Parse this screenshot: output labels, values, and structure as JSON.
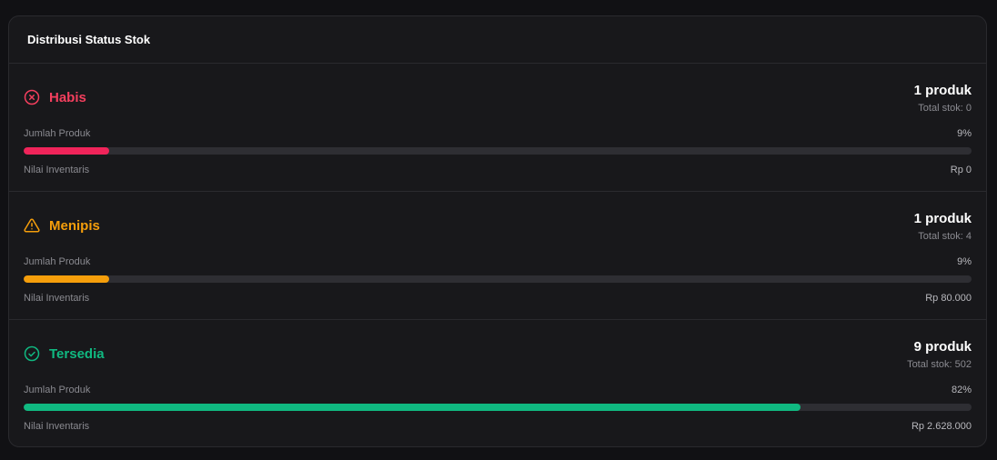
{
  "card": {
    "title": "Distribusi Status Stok"
  },
  "rows": [
    {
      "status": "Habis",
      "icon": "x-circle-icon",
      "color": "#f43f5e",
      "bar_color": "#f0245a",
      "count": "1 produk",
      "total": "Total stok: 0",
      "metric_label": "Jumlah Produk",
      "percent": "9%",
      "fill_percent": 9,
      "value_label": "Nilai Inventaris",
      "value": "Rp 0"
    },
    {
      "status": "Menipis",
      "icon": "warning-triangle-icon",
      "color": "#f59e0b",
      "bar_color": "#f59e0b",
      "count": "1 produk",
      "total": "Total stok: 4",
      "metric_label": "Jumlah Produk",
      "percent": "9%",
      "fill_percent": 9,
      "value_label": "Nilai Inventaris",
      "value": "Rp 80.000"
    },
    {
      "status": "Tersedia",
      "icon": "check-circle-icon",
      "color": "#10b981",
      "bar_color": "#10b981",
      "count": "9 produk",
      "total": "Total stok: 502",
      "metric_label": "Jumlah Produk",
      "percent": "82%",
      "fill_percent": 82,
      "value_label": "Nilai Inventaris",
      "value": "Rp 2.628.000"
    }
  ]
}
